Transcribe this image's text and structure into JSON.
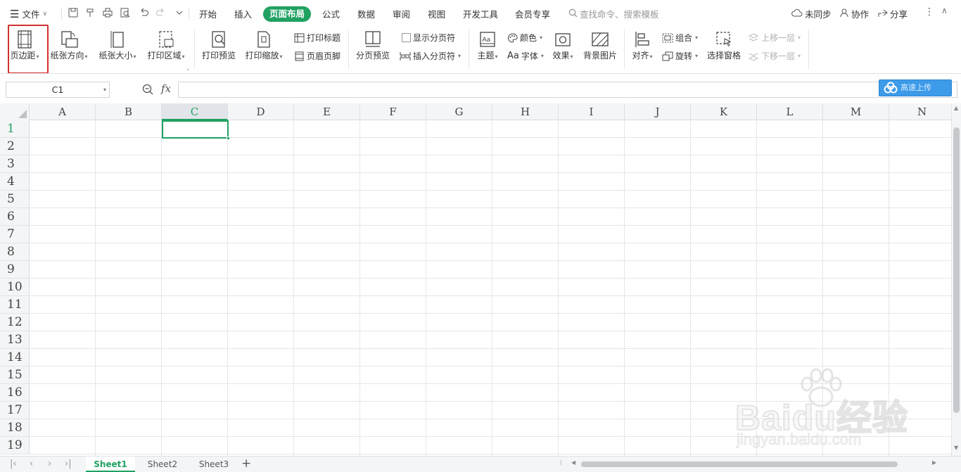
{
  "menubar": {
    "file_label": "文件",
    "tabs": [
      "开始",
      "插入",
      "页面布局",
      "公式",
      "数据",
      "审阅",
      "视图",
      "开发工具",
      "会员专享"
    ],
    "active_tab": "页面布局",
    "search_placeholder": "查找命令、搜索模板",
    "sync_label": "未同步",
    "collab_label": "协作",
    "share_label": "分享"
  },
  "ribbon": {
    "margins": "页边距",
    "orientation": "纸张方向",
    "size": "纸张大小",
    "print_area": "打印区域",
    "print_preview": "打印预览",
    "print_scale": "打印缩放",
    "print_titles": "打印标题",
    "header_footer": "页眉页脚",
    "page_break_preview": "分页预览",
    "show_page_breaks": "显示分页符",
    "insert_page_break": "插入分页符",
    "theme": "主题",
    "colors": "颜色",
    "fonts": "字体",
    "fonts_prefix": "Aa",
    "effects": "效果",
    "background": "背景图片",
    "align": "对齐",
    "group": "组合",
    "rotate": "旋转",
    "selection_pane": "选择窗格",
    "bring_forward": "上移一层",
    "send_backward": "下移一层"
  },
  "formula_bar": {
    "cell_ref": "C1",
    "fx": "fx",
    "formula": "",
    "upload_label": "高速上传"
  },
  "grid": {
    "columns": [
      "A",
      "B",
      "C",
      "D",
      "E",
      "F",
      "G",
      "H",
      "I",
      "J",
      "K",
      "L",
      "M",
      "N"
    ],
    "rows": [
      "1",
      "2",
      "3",
      "4",
      "5",
      "6",
      "7",
      "8",
      "9",
      "10",
      "11",
      "12",
      "13",
      "14",
      "15",
      "16",
      "17",
      "18",
      "19"
    ],
    "selected_cell": "C1"
  },
  "sheets": [
    "Sheet1",
    "Sheet2",
    "Sheet3"
  ],
  "active_sheet": "Sheet1",
  "watermark": {
    "brand": "Baidu经验",
    "url": "jingyan.baidu.com"
  },
  "colors": {
    "accent": "#20a162",
    "highlight": "#d42f2f"
  }
}
